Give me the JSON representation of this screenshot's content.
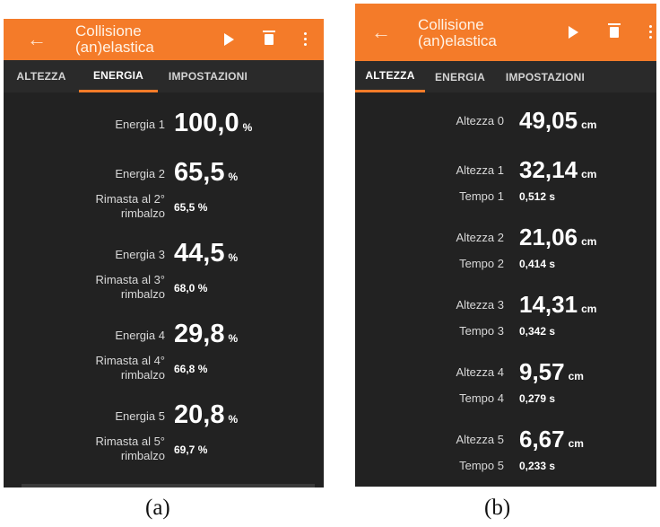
{
  "panel_a": {
    "title_line1": "Collisione",
    "title_line2": "(an)elastica",
    "tabs": [
      "ALTEZZA",
      "ENERGIA",
      "IMPOSTAZIONI"
    ],
    "active_tab": "ENERGIA",
    "rows": [
      {
        "label": "Energia 1",
        "value": "100,0",
        "unit": "%"
      },
      {
        "label": "Energia 2",
        "value": "65,5",
        "unit": "%",
        "sub_label_1": "Rimasta al 2°",
        "sub_label_2": "rimbalzo",
        "sub_value": "65,5 %"
      },
      {
        "label": "Energia 3",
        "value": "44,5",
        "unit": "%",
        "sub_label_1": "Rimasta al 3°",
        "sub_label_2": "rimbalzo",
        "sub_value": "68,0 %"
      },
      {
        "label": "Energia 4",
        "value": "29,8",
        "unit": "%",
        "sub_label_1": "Rimasta al 4°",
        "sub_label_2": "rimbalzo",
        "sub_value": "66,8 %"
      },
      {
        "label": "Energia 5",
        "value": "20,8",
        "unit": "%",
        "sub_label_1": "Rimasta al 5°",
        "sub_label_2": "rimbalzo",
        "sub_value": "69,7 %"
      }
    ],
    "caption": "(a)"
  },
  "panel_b": {
    "title_line1": "Collisione",
    "title_line2": "(an)elastica",
    "tabs": [
      "ALTEZZA",
      "ENERGIA",
      "IMPOSTAZIONI"
    ],
    "active_tab": "ALTEZZA",
    "rows": [
      {
        "label": "Altezza 0",
        "value": "49,05",
        "unit": "cm"
      },
      {
        "label": "Altezza 1",
        "value": "32,14",
        "unit": "cm",
        "time_label": "Tempo 1",
        "time_value": "0,512 s"
      },
      {
        "label": "Altezza 2",
        "value": "21,06",
        "unit": "cm",
        "time_label": "Tempo 2",
        "time_value": "0,414 s"
      },
      {
        "label": "Altezza 3",
        "value": "14,31",
        "unit": "cm",
        "time_label": "Tempo 3",
        "time_value": "0,342 s"
      },
      {
        "label": "Altezza 4",
        "value": "9,57",
        "unit": "cm",
        "time_label": "Tempo 4",
        "time_value": "0,279 s"
      },
      {
        "label": "Altezza 5",
        "value": "6,67",
        "unit": "cm",
        "time_label": "Tempo 5",
        "time_value": "0,233 s"
      }
    ],
    "caption": "(b)"
  },
  "colors": {
    "accent": "#f47b29",
    "background": "#222222",
    "text": "#ffffff"
  },
  "icons": [
    "back-arrow-icon",
    "play-icon",
    "trash-icon",
    "more-vert-icon"
  ]
}
